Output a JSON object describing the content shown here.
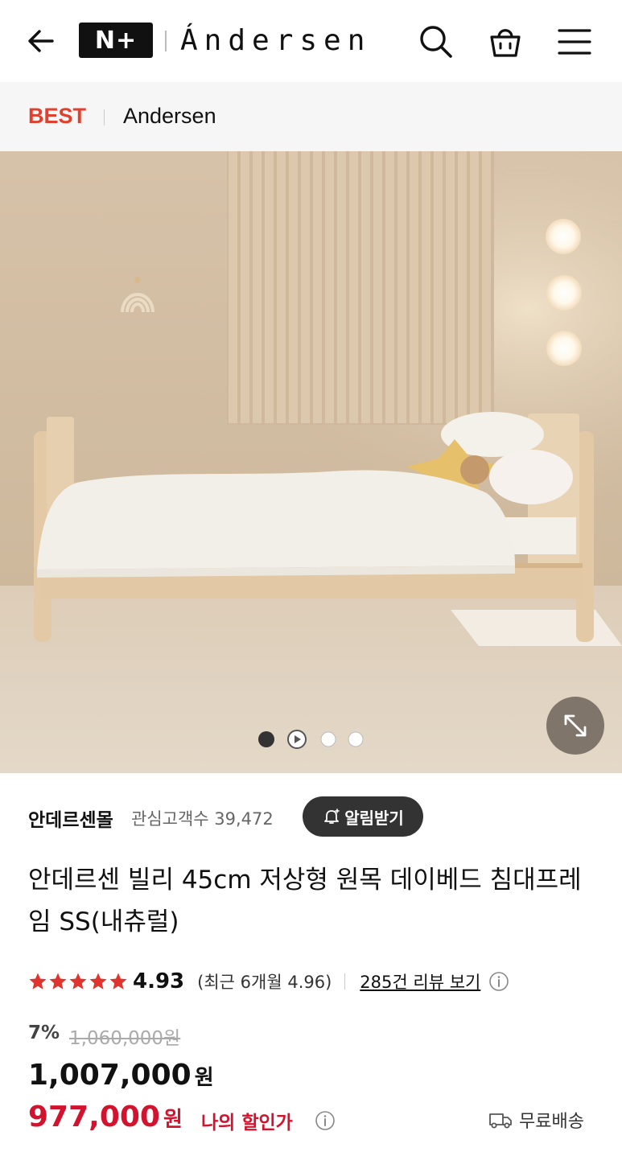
{
  "header": {
    "back_icon": "arrow-left-icon",
    "nplus_logo": "N+",
    "brand_logo": "Ándersen",
    "search_icon": "search-icon",
    "cart_icon": "shopping-bag-icon",
    "menu_icon": "hamburger-menu-icon"
  },
  "category_bar": {
    "best_label": "BEST",
    "brand_label": "Andersen"
  },
  "gallery": {
    "indicator_count": 4,
    "active_index": 0,
    "video_index": 1,
    "expand_icon": "expand-icon"
  },
  "store": {
    "name": "안데르센몰",
    "watchers_label": "관심고객수 39,472",
    "alarm_button": "알림받기"
  },
  "product": {
    "title": "안데르센 빌리 45cm 저상형 원목 데이베드 침대프레임 SS(내츄럴)",
    "rating": {
      "stars": 5,
      "score": "4.93",
      "recent": "(최근 6개월 4.96)",
      "review_link": "285건 리뷰 보기"
    },
    "pricing": {
      "discount_rate": "7%",
      "original_price": "1,060,000원",
      "price": "1,007,000",
      "price_unit": "원",
      "my_price": "977,000",
      "my_price_unit": "원",
      "my_discount_label": "나의 할인가"
    },
    "shipping_label": "무료배송"
  },
  "colors": {
    "accent_red": "#d3132e",
    "best_red": "#e0402e",
    "star_red": "#e0342e"
  }
}
